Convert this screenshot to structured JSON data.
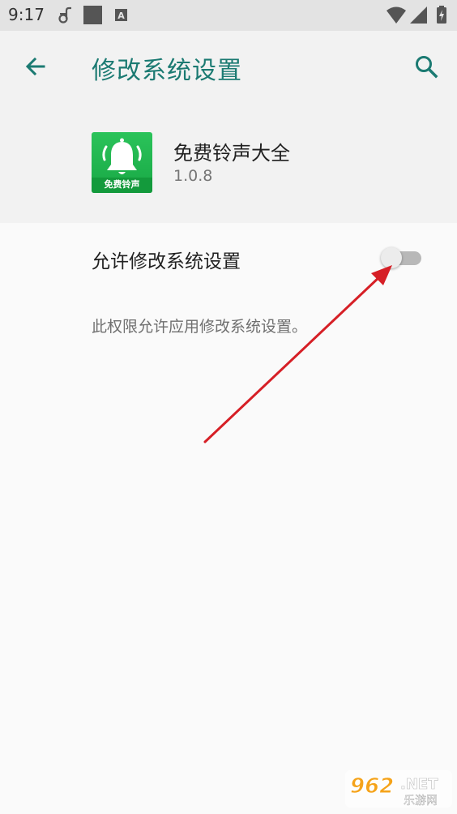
{
  "status_bar": {
    "time": "9:17",
    "icons_left": [
      "sync-icon",
      "square-icon",
      "font-icon"
    ],
    "icons_right": [
      "wifi-icon",
      "signal-icon",
      "battery-icon"
    ]
  },
  "header": {
    "title": "修改系统设置",
    "back_icon": "arrow-left-icon",
    "search_icon": "search-icon"
  },
  "app": {
    "name": "免费铃声大全",
    "version": "1.0.8",
    "icon_label": "免费铃声",
    "icon": "bell-icon"
  },
  "permission": {
    "label": "允许修改系统设置",
    "enabled": false,
    "description": "此权限允许应用修改系统设置。"
  },
  "watermark": {
    "brand": "962",
    "suffix": ".NET",
    "subtitle": "乐游网"
  },
  "colors": {
    "accent": "#1b7a72",
    "app_icon_green": "#22b850",
    "annotation_arrow": "#d61f26"
  }
}
